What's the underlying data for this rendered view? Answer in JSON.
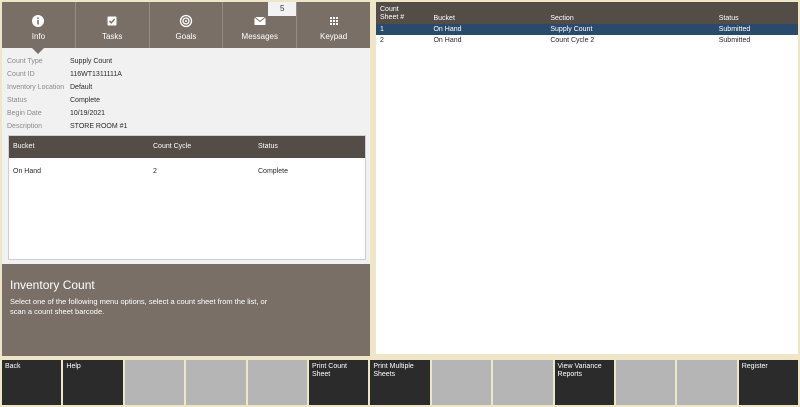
{
  "tabs": [
    {
      "label": "Info",
      "icon": "info-icon",
      "active": true
    },
    {
      "label": "Tasks",
      "icon": "checkbox-icon",
      "active": false
    },
    {
      "label": "Goals",
      "icon": "target-icon",
      "active": false
    },
    {
      "label": "Messages",
      "icon": "envelope-icon",
      "active": false,
      "badge": "5"
    },
    {
      "label": "Keypad",
      "icon": "keypad-icon",
      "active": false
    }
  ],
  "details": [
    {
      "key": "Count Type",
      "value": "Supply Count"
    },
    {
      "key": "Count ID",
      "value": "116WT1311111A"
    },
    {
      "key": "Inventory Location",
      "value": "Default"
    },
    {
      "key": "Status",
      "value": "Complete"
    },
    {
      "key": "Begin Date",
      "value": "10/19/2021"
    },
    {
      "key": "Description",
      "value": "STORE ROOM #1"
    }
  ],
  "bucket_table": {
    "headers": [
      "Bucket",
      "Count Cycle",
      "Status"
    ],
    "rows": [
      [
        "On Hand",
        "2",
        "Complete"
      ]
    ]
  },
  "info_box": {
    "title": "Inventory Count",
    "text": "Select one of the following menu options, select a count sheet from the list, or scan a count sheet barcode."
  },
  "sheet_table": {
    "headers": {
      "sheet_line1": "Count",
      "sheet_line2": "Sheet #",
      "bucket": "Bucket",
      "section": "Section",
      "status": "Status"
    },
    "rows": [
      {
        "sheet": "1",
        "bucket": "On Hand",
        "section": "Supply Count",
        "status": "Submitted",
        "selected": true
      },
      {
        "sheet": "2",
        "bucket": "On Hand",
        "section": "Count Cycle 2",
        "status": "Submitted",
        "selected": false
      }
    ]
  },
  "function_keys": [
    {
      "label": "Back",
      "enabled": true
    },
    {
      "label": "Help",
      "enabled": true
    },
    {
      "label": "",
      "enabled": false
    },
    {
      "label": "",
      "enabled": false
    },
    {
      "label": "",
      "enabled": false
    },
    {
      "label": "Print Count Sheet",
      "enabled": true
    },
    {
      "label": "Print Multiple Sheets",
      "enabled": true
    },
    {
      "label": "",
      "enabled": false
    },
    {
      "label": "",
      "enabled": false
    },
    {
      "label": "View Variance Reports",
      "enabled": true
    },
    {
      "label": "",
      "enabled": false
    },
    {
      "label": "",
      "enabled": false
    },
    {
      "label": "Register",
      "enabled": true
    }
  ],
  "colors": {
    "background": "#efe6c8",
    "tab_bar": "#7a6f67",
    "table_header": "#544c47",
    "selected_row": "#2a4a6c",
    "key_enabled": "#2b2b2b",
    "key_disabled": "#b5b5b5"
  }
}
